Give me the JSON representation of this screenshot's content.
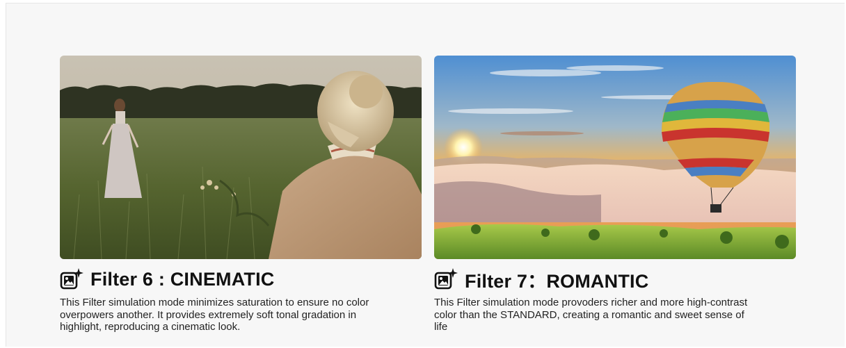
{
  "cards": [
    {
      "title": "Filter 6 : CINEMATIC",
      "description": "This Filter simulation mode minimizes saturation to ensure no color overpowers another. It provides extremely soft tonal gradation in highlight, reproducing a cinematic look.",
      "icon": "filter-photo-sparkle-icon"
    },
    {
      "title": "Filter 7：ROMANTIC",
      "description": "This Filter simulation mode provoders richer and more high-contrast color than the STANDARD, creating a romantic and sweet sense of life",
      "icon": "filter-photo-sparkle-icon"
    }
  ]
}
